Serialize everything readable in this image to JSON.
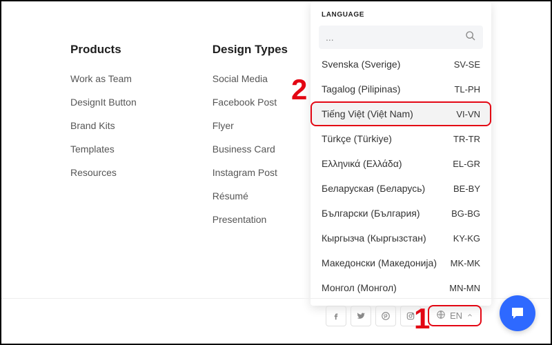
{
  "footer": {
    "columns": [
      {
        "heading": "Products",
        "items": [
          "Work as Team",
          "DesignIt Button",
          "Brand Kits",
          "Templates",
          "Resources"
        ]
      },
      {
        "heading": "Design Types",
        "items": [
          "Social Media",
          "Facebook Post",
          "Flyer",
          "Business Card",
          "Instagram Post",
          "Résumé",
          "Presentation"
        ]
      }
    ]
  },
  "language_panel": {
    "header": "LANGUAGE",
    "search_placeholder": "...",
    "highlight_code": "VI-VN",
    "items": [
      {
        "name": "Svenska (Sverige)",
        "code": "SV-SE"
      },
      {
        "name": "Tagalog (Pilipinas)",
        "code": "TL-PH"
      },
      {
        "name": "Tiếng Việt (Việt Nam)",
        "code": "VI-VN"
      },
      {
        "name": "Türkçe (Türkiye)",
        "code": "TR-TR"
      },
      {
        "name": "Ελληνικά (Ελλάδα)",
        "code": "EL-GR"
      },
      {
        "name": "Беларуская (Беларусь)",
        "code": "BE-BY"
      },
      {
        "name": "Български (България)",
        "code": "BG-BG"
      },
      {
        "name": "Кыргызча (Кыргызстан)",
        "code": "KY-KG"
      },
      {
        "name": "Македонски (Македонија)",
        "code": "MK-MK"
      },
      {
        "name": "Монгол (Монгол)",
        "code": "MN-MN"
      }
    ]
  },
  "language_toggle": {
    "current": "EN"
  },
  "annotations": {
    "one": "1",
    "two": "2"
  },
  "colors": {
    "accent_red": "#e30613",
    "chat_blue": "#2e69ff"
  }
}
